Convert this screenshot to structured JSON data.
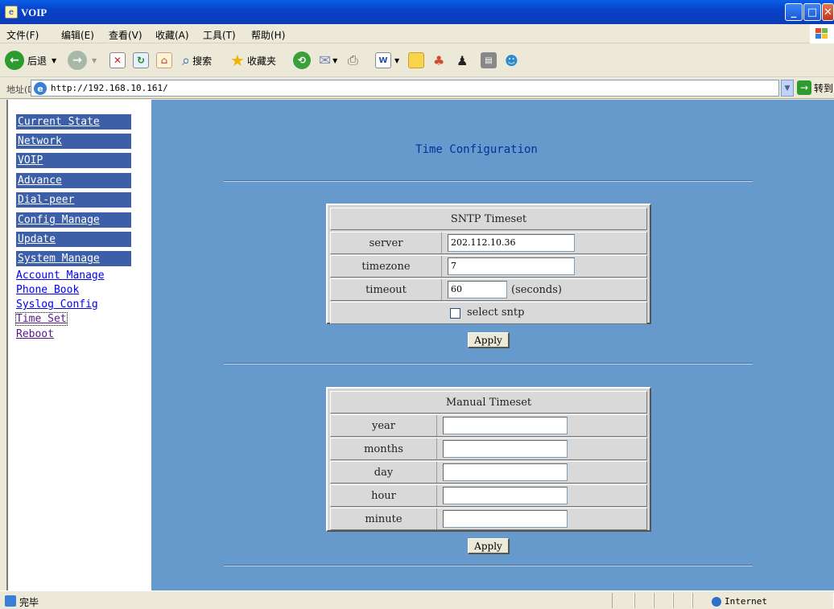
{
  "window": {
    "title": "VOIP"
  },
  "menu": [
    "文件(F)",
    "编辑(E)",
    "查看(V)",
    "收藏(A)",
    "工具(T)",
    "帮助(H)"
  ],
  "toolbar": {
    "back": "后退",
    "search": "搜索",
    "favorites": "收藏夹"
  },
  "address": {
    "label": "地址(D)",
    "url": "http://192.168.10.161/",
    "go": "转到"
  },
  "sidebar": {
    "buttons": [
      "Current State",
      "Network",
      "VOIP",
      "Advance",
      "Dial-peer",
      "Config Manage",
      "Update",
      "System Manage"
    ],
    "links": [
      "Account Manage",
      "Phone Book",
      "Syslog Config",
      "Time Set",
      "Reboot"
    ]
  },
  "main": {
    "title": "Time Configuration",
    "sntp": {
      "header": "SNTP Timeset",
      "server_label": "server",
      "server_value": "202.112.10.36",
      "timezone_label": "timezone",
      "timezone_value": "7",
      "timeout_label": "timeout",
      "timeout_value": "60",
      "timeout_unit": "(seconds)",
      "select_label": "select sntp",
      "select_checked": false,
      "apply": "Apply"
    },
    "manual": {
      "header": "Manual Timeset",
      "fields": [
        "year",
        "months",
        "day",
        "hour",
        "minute"
      ],
      "values": [
        "",
        "",
        "",
        "",
        ""
      ],
      "apply": "Apply"
    }
  },
  "status": {
    "text": "完毕",
    "zone": "Internet"
  }
}
